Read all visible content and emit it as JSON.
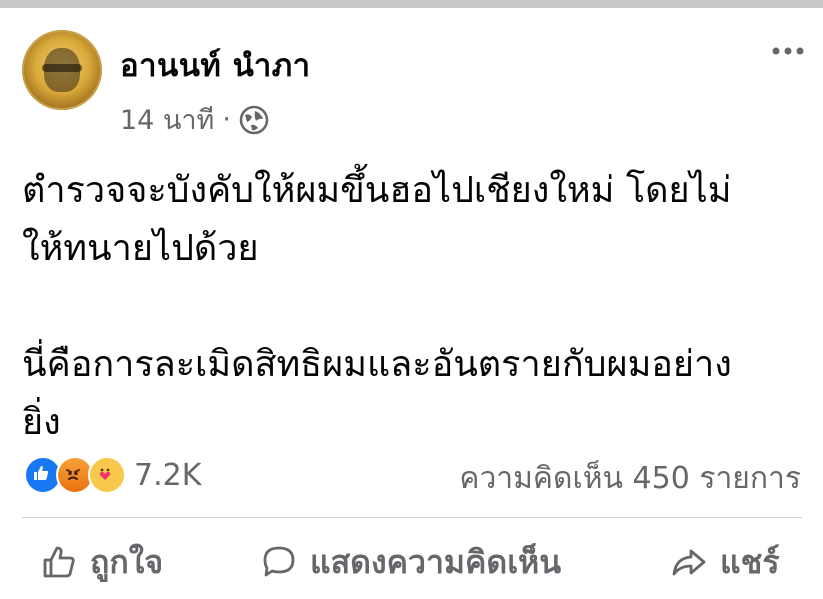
{
  "post": {
    "author": "อานนท์ นำภา",
    "time": "14 นาที",
    "separator": "·",
    "privacy_icon": "globe-icon",
    "body": "ตำรวจจะบังคับให้ผมขึ้นฮอไปเชียงใหม่  โดยไม่\nให้ทนายไปด้วย\n\nนี่คือการละเมิดสิทธิผมและอันตรายกับผมอย่าง\nยิ่ง"
  },
  "stats": {
    "reactions_count": "7.2K",
    "comments_label": "ความคิดเห็น 450 รายการ"
  },
  "actions": {
    "like_label": "ถูกใจ",
    "comment_label": "แสดงความคิดเห็น",
    "share_label": "แชร์"
  },
  "colors": {
    "like": "#1877f2",
    "muted_text": "#65676b",
    "divider": "#ced0d4"
  }
}
